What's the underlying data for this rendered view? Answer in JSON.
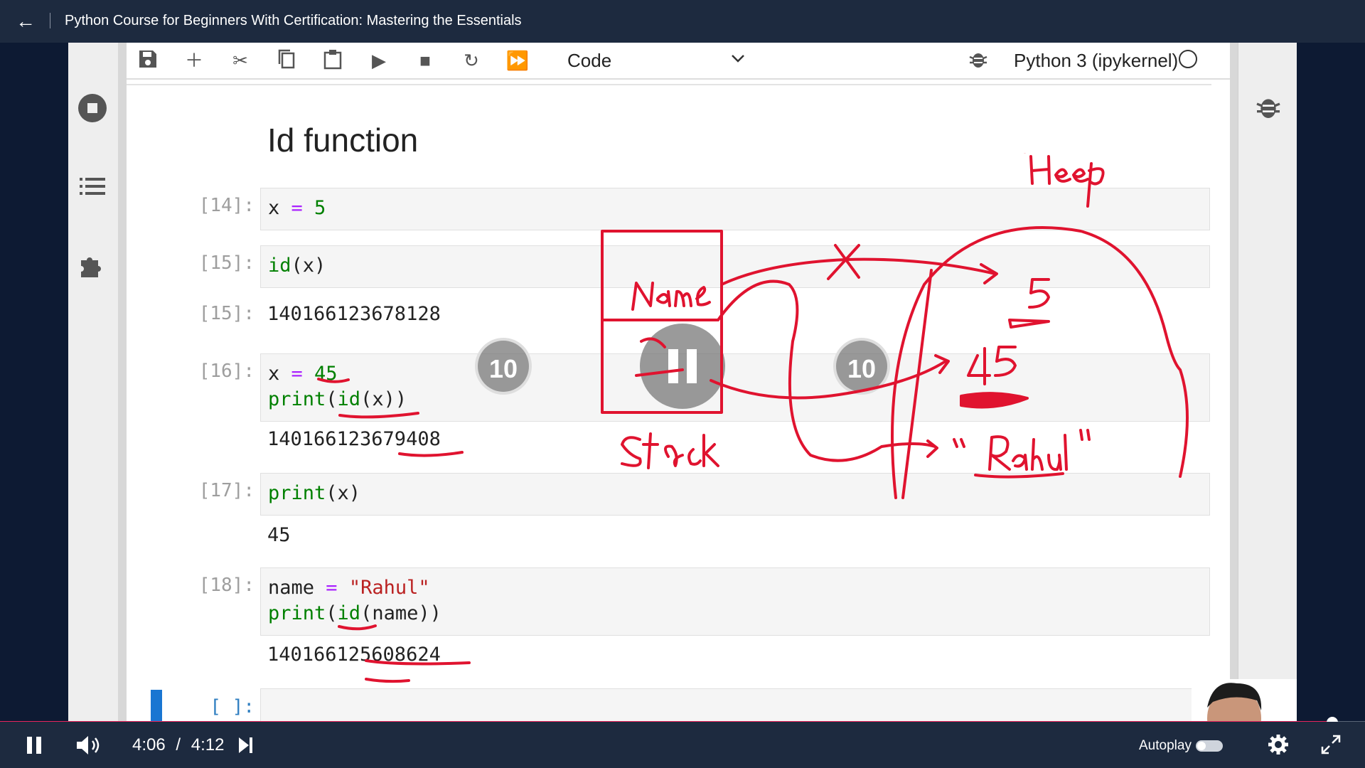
{
  "header": {
    "back_label": "←",
    "title": "Python Course for Beginners With Certification: Mastering the Essentials"
  },
  "toolbar": {
    "cell_type": "Code",
    "kernel": "Python 3 (ipykernel)"
  },
  "notebook": {
    "heading": "Id function",
    "cells": [
      {
        "prompt": "[14]:",
        "code": "x = 5"
      },
      {
        "prompt": "[15]:",
        "code": "id(x)",
        "out_prompt": "[15]:",
        "output": "140166123678128"
      },
      {
        "prompt": "[16]:",
        "code_l1": "x = 45",
        "code_l2": "print(id(x))",
        "output": "140166123679408"
      },
      {
        "prompt": "[17]:",
        "code": "print(x)",
        "output": "45"
      },
      {
        "prompt": "[18]:",
        "code_l1": "name = \"Rahul\"",
        "code_l2": "print(id(name))",
        "output": "140166125608624"
      },
      {
        "prompt": "[ ]:"
      }
    ]
  },
  "overlay": {
    "rewind_label": "10",
    "forward_label": "10"
  },
  "annotations": {
    "heap": "Heap",
    "name": "Name",
    "stack": "Stack",
    "val_5": "5",
    "val_45": "45",
    "val_rahul": "\" Rahul \""
  },
  "player": {
    "current_time": "4:06",
    "separator": "/",
    "duration": "4:12",
    "autoplay_label": "Autoplay",
    "autoplay_on": false,
    "progress": 0.976,
    "accent_color": "#e8245b"
  }
}
